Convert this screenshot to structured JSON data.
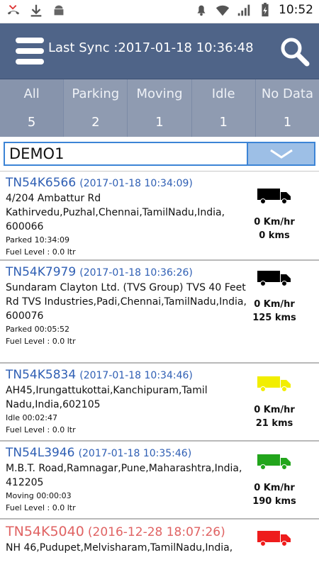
{
  "status_bar": {
    "time": "10:52"
  },
  "header": {
    "sync_label": "Last Sync :2017-01-18 10:36:48"
  },
  "tabs": [
    {
      "label": "All",
      "count": "5"
    },
    {
      "label": "Parking",
      "count": "2"
    },
    {
      "label": "Moving",
      "count": "1"
    },
    {
      "label": "Idle",
      "count": "1"
    },
    {
      "label": "No Data",
      "count": "1"
    }
  ],
  "filter": {
    "value": "DEMO1"
  },
  "vehicles": [
    {
      "plate": "TN54K6566",
      "time": "(2017-01-18 10:34:09)",
      "address": "4/204  Ambattur Rd Kathirvedu,Puzhal,Chennai,TamilNadu,India, 600066",
      "status": "Parked 10:34:09",
      "fuel": "Fuel Level : 0.0 ltr",
      "speed": "0 Km/hr",
      "distance": "0 kms",
      "truck_color": "#000000"
    },
    {
      "plate": "TN54K7979",
      "time": "(2017-01-18 10:36:26)",
      "address": "Sundaram Clayton Ltd. (TVS Group)  TVS 40 Feet Rd  TVS Industries,Padi,Chennai,TamilNadu,India, 600076",
      "status": "Parked 00:05:52",
      "fuel": "Fuel Level : 0.0 ltr",
      "speed": "0 Km/hr",
      "distance": "125 kms",
      "truck_color": "#000000"
    },
    {
      "plate": "TN54K5834",
      "time": "(2017-01-18 10:34:46)",
      "address": "AH45,Irungattukottai,Kanchipuram,Tamil Nadu,India,602105",
      "status": "Idle 00:02:47",
      "fuel": "Fuel Level : 0.0 ltr",
      "speed": "0 Km/hr",
      "distance": "21 kms",
      "truck_color": "#f2ee00"
    },
    {
      "plate": "TN54L3946",
      "time": "(2017-01-18 10:35:46)",
      "address": "M.B.T. Road,Ramnagar,Pune,Maharashtra,India, 412205",
      "status": "Moving 00:00:03",
      "fuel": "Fuel Level : 0.0 ltr",
      "speed": "0 Km/hr",
      "distance": "190 kms",
      "truck_color": "#22a51c"
    },
    {
      "plate": "TN54K5040",
      "time": "(2016-12-28 18:07:26)",
      "address": "NH 46,Pudupet,Melvisharam,TamilNadu,India,",
      "truck_color": "#ee1c1c"
    }
  ]
}
